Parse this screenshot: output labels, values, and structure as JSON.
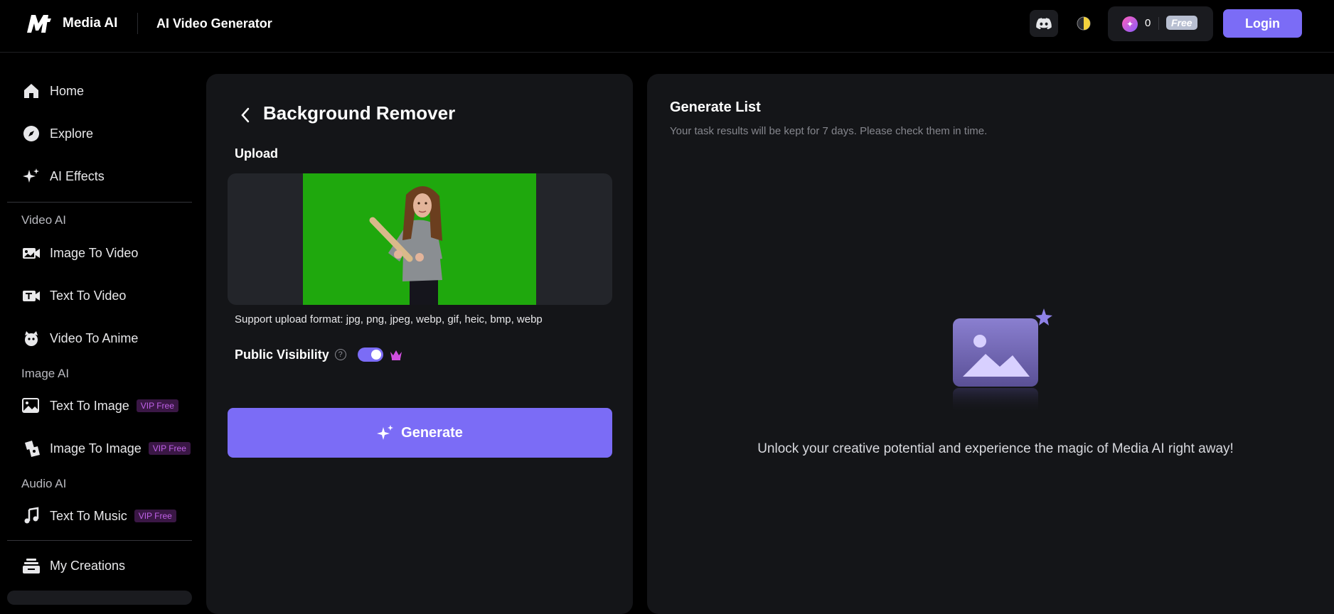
{
  "header": {
    "brand": "Media AI",
    "page_title": "AI Video Generator",
    "credits": "0",
    "plan_badge": "Free",
    "login_label": "Login"
  },
  "sidebar": {
    "items": [
      {
        "label": "Home",
        "icon": "home-icon"
      },
      {
        "label": "Explore",
        "icon": "compass-icon"
      },
      {
        "label": "AI Effects",
        "icon": "sparkles-icon"
      }
    ],
    "video_section": "Video AI",
    "video_items": [
      {
        "label": "Image To Video",
        "icon": "image-video-icon"
      },
      {
        "label": "Text To Video",
        "icon": "text-video-icon"
      },
      {
        "label": "Video To Anime",
        "icon": "anime-icon"
      }
    ],
    "image_section": "Image AI",
    "image_items": [
      {
        "label": "Text To Image",
        "badge": "VIP Free",
        "icon": "text-image-icon"
      },
      {
        "label": "Image To Image",
        "badge": "VIP Free",
        "icon": "image-image-icon"
      }
    ],
    "audio_section": "Audio AI",
    "audio_items": [
      {
        "label": "Text To Music",
        "badge": "VIP Free",
        "icon": "music-icon"
      }
    ],
    "my_creations": "My Creations"
  },
  "tool": {
    "title": "Background Remover",
    "upload_label": "Upload",
    "support_text": "Support upload format: jpg, png, jpeg, webp, gif, heic, bmp, webp",
    "visibility_label": "Public Visibility",
    "visibility_on": true,
    "generate_label": "Generate"
  },
  "results": {
    "title": "Generate List",
    "subtitle": "Your task results will be kept for 7 days. Please check them in time.",
    "empty_text": "Unlock your creative potential and experience the magic of Media AI right away!"
  },
  "colors": {
    "accent": "#7b6cf6",
    "background": "#000000",
    "panel": "#141518",
    "vip": "#c061e8"
  }
}
